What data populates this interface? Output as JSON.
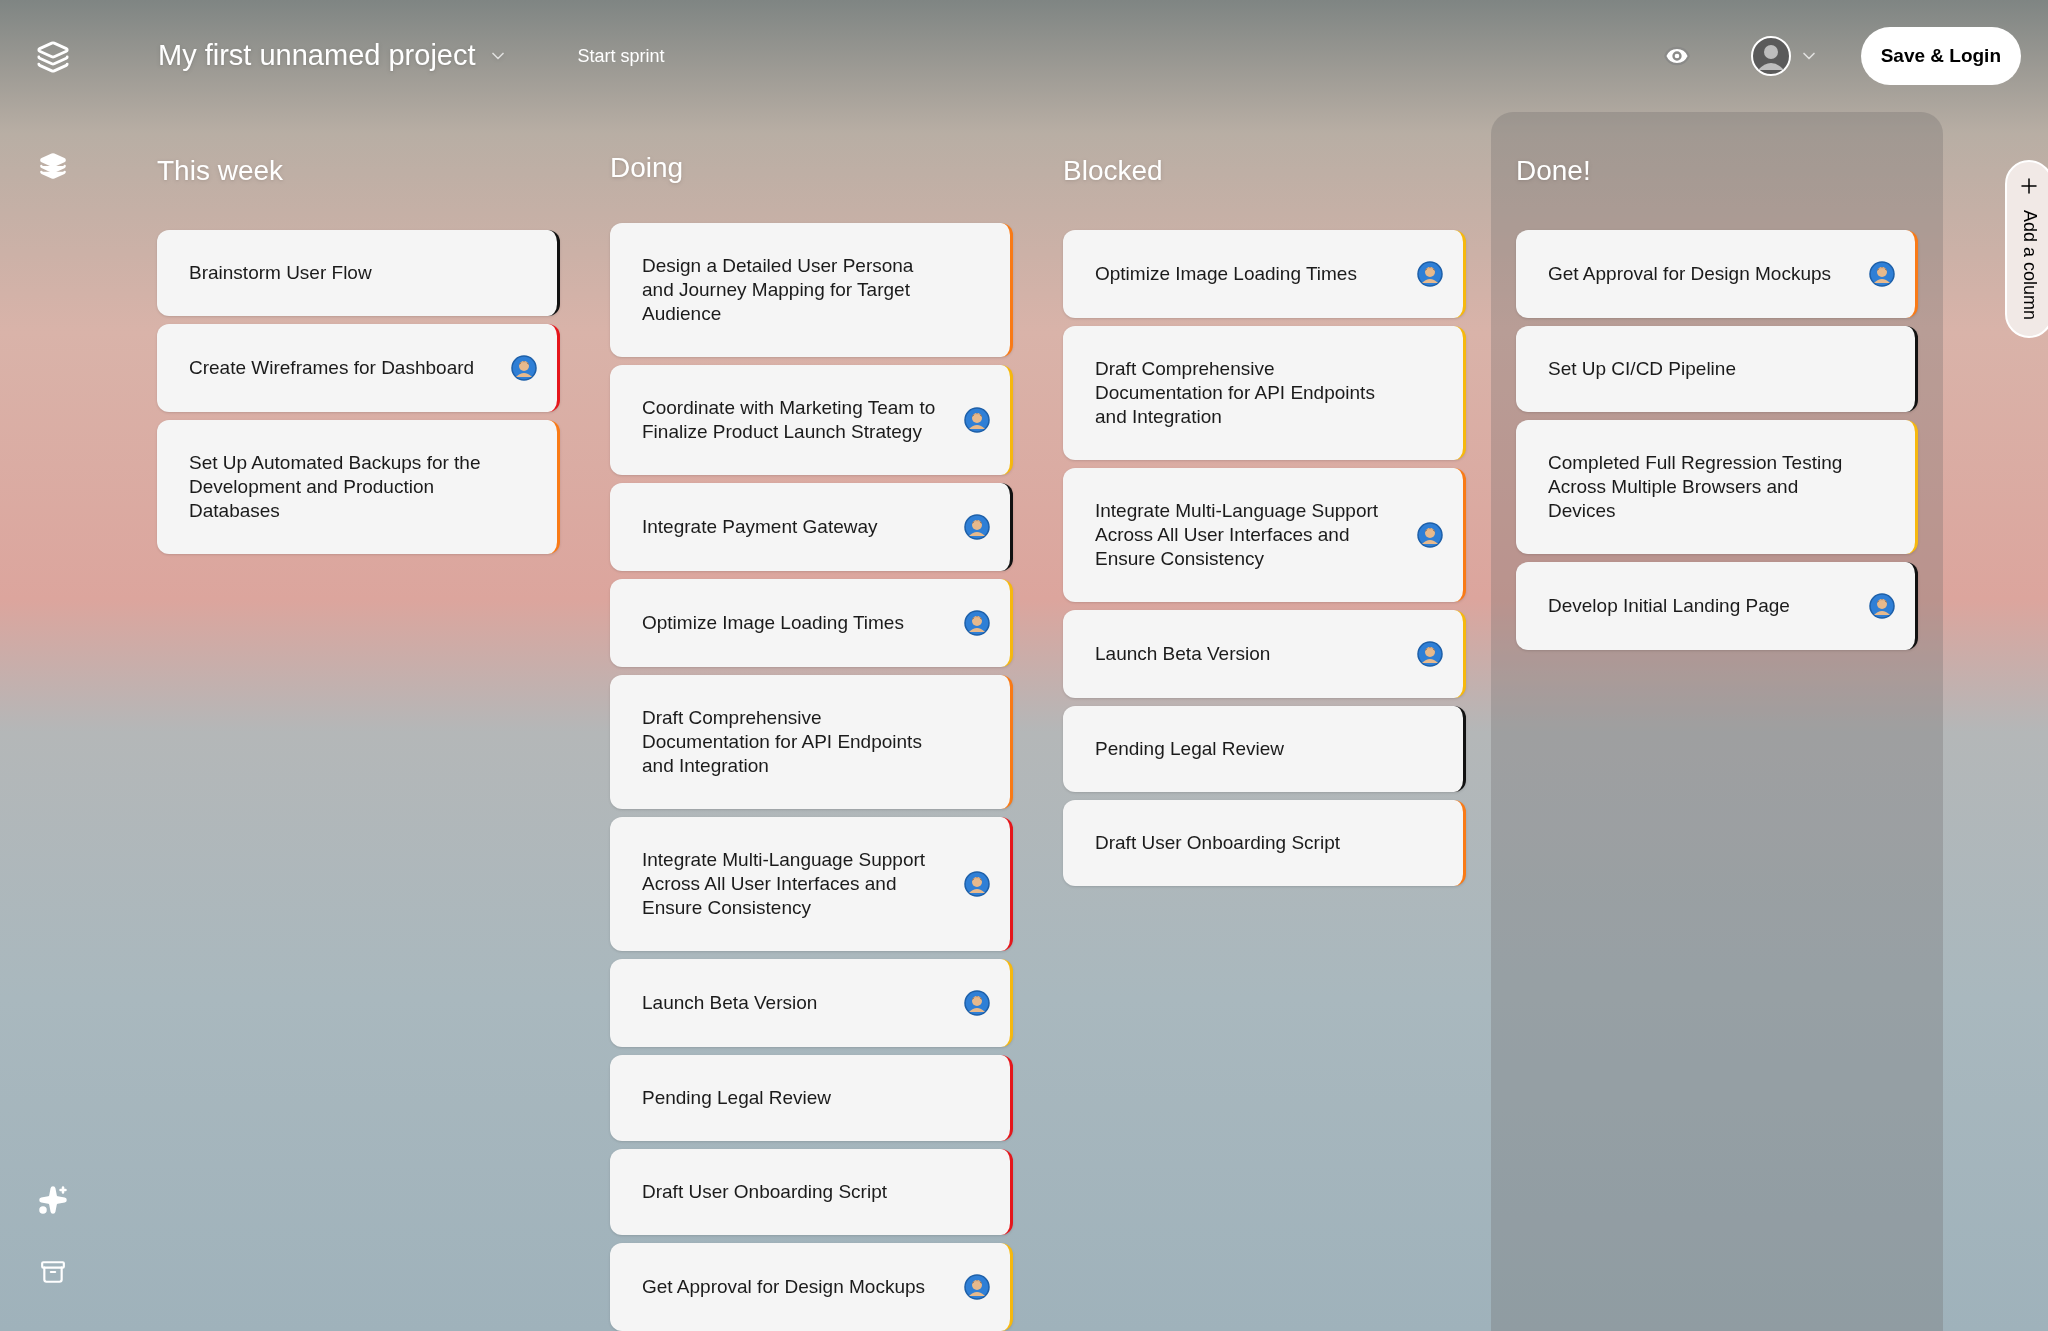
{
  "header": {
    "project": "My first unnamed project",
    "sprint_button": "Start sprint",
    "save_button": "Save & Login"
  },
  "columns": [
    {
      "title": "This week",
      "highlighted": false,
      "cards": [
        {
          "title": "Brainstorm User Flow",
          "color": "#111111",
          "assigned": false
        },
        {
          "title": "Create Wireframes for Dashboard",
          "color": "#e5161b",
          "assigned": true
        },
        {
          "title": "Set Up Automated Backups for the Development and Production Databases",
          "color": "#f97a16",
          "assigned": false
        }
      ]
    },
    {
      "title": "Doing",
      "highlighted": false,
      "cards": [
        {
          "title": "Design a Detailed User Persona and Journey Mapping for Target Audience",
          "color": "#f97a16",
          "assigned": false
        },
        {
          "title": "Coordinate with Marketing Team to Finalize Product Launch Strategy",
          "color": "#f6b80e",
          "assigned": true
        },
        {
          "title": "Integrate Payment Gateway",
          "color": "#111111",
          "assigned": true
        },
        {
          "title": "Optimize Image Loading Times",
          "color": "#f6b80e",
          "assigned": true
        },
        {
          "title": "Draft Comprehensive Documentation for API Endpoints and Integration",
          "color": "#f97a16",
          "assigned": false
        },
        {
          "title": "Integrate Multi-Language Support Across All User Interfaces and Ensure Consistency",
          "color": "#e5161b",
          "assigned": true
        },
        {
          "title": "Launch Beta Version",
          "color": "#f6b80e",
          "assigned": true
        },
        {
          "title": "Pending Legal Review",
          "color": "#e5161b",
          "assigned": false
        },
        {
          "title": "Draft User Onboarding Script",
          "color": "#e5161b",
          "assigned": false
        },
        {
          "title": "Get Approval for Design Mockups",
          "color": "#f6b80e",
          "assigned": true
        }
      ]
    },
    {
      "title": "Blocked",
      "highlighted": false,
      "cards": [
        {
          "title": "Optimize Image Loading Times",
          "color": "#f6b80e",
          "assigned": true
        },
        {
          "title": "Draft Comprehensive Documentation for API Endpoints and Integration",
          "color": "#f6b80e",
          "assigned": false
        },
        {
          "title": "Integrate Multi-Language Support Across All User Interfaces and Ensure Consistency",
          "color": "#f97a16",
          "assigned": true
        },
        {
          "title": "Launch Beta Version",
          "color": "#f6b80e",
          "assigned": true
        },
        {
          "title": "Pending Legal Review",
          "color": "#111111",
          "assigned": false
        },
        {
          "title": "Draft User Onboarding Script",
          "color": "#f97a16",
          "assigned": false
        }
      ]
    },
    {
      "title": "Done!",
      "highlighted": true,
      "cards": [
        {
          "title": "Get Approval for Design Mockups",
          "color": "#f97a16",
          "assigned": true
        },
        {
          "title": "Set Up CI/CD Pipeline",
          "color": "#111111",
          "assigned": false
        },
        {
          "title": "Completed Full Regression Testing Across Multiple Browsers and Devices",
          "color": "#f6b80e",
          "assigned": false
        },
        {
          "title": "Develop Initial Landing Page",
          "color": "#111111",
          "assigned": true
        }
      ]
    }
  ],
  "add_column": "Add a column"
}
